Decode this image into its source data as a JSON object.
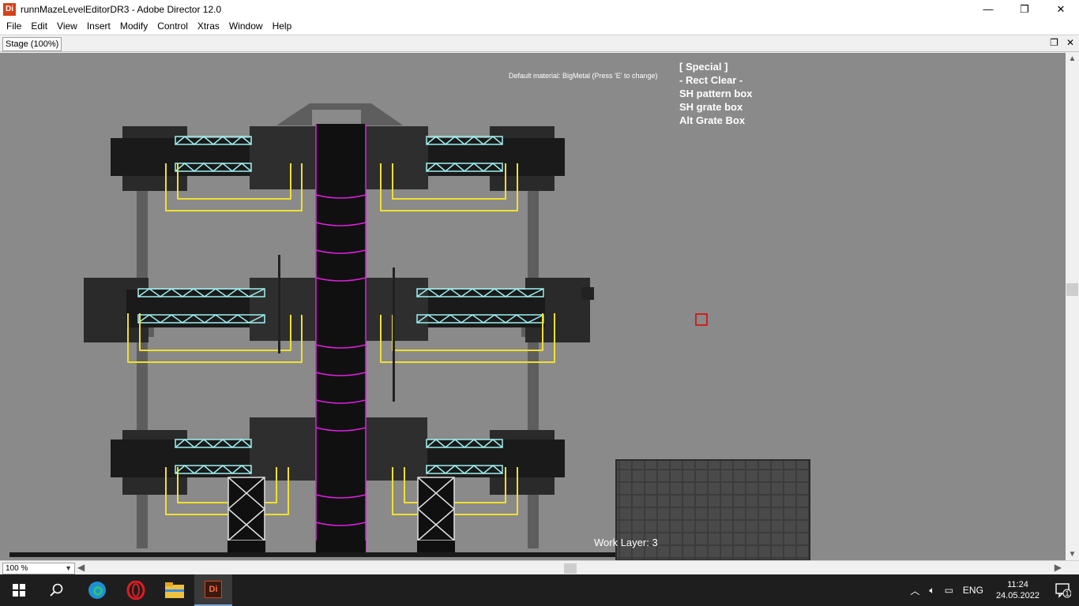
{
  "window": {
    "app_icon_label": "Di",
    "title": "runnMazeLevelEditorDR3 - Adobe Director 12.0",
    "minimize_glyph": "—",
    "restore_glyph": "❐",
    "close_glyph": "✕"
  },
  "menu": {
    "items": [
      "File",
      "Edit",
      "View",
      "Insert",
      "Modify",
      "Control",
      "Xtras",
      "Window",
      "Help"
    ]
  },
  "stage_tab": {
    "label": "Stage (100%)"
  },
  "hud": {
    "material": "Default material: BigMetal (Press 'E' to change)",
    "panel_lines": [
      "[ Special ]",
      "- Rect Clear -",
      "SH pattern box",
      "SH grate box",
      "Alt Grate Box"
    ],
    "work_layer": "Work Layer: 3"
  },
  "bottom": {
    "zoom_value": "100 %"
  },
  "taskbar": {
    "language": "ENG",
    "time": "11:24",
    "date": "24.05.2022",
    "notification_count": "1",
    "director_label": "Di"
  },
  "colors": {
    "stage_bg": "#8a8a8a",
    "pipe_yellow": "#f0e030",
    "column_magenta": "#e020e0",
    "girder_cyan": "#a0f0f0",
    "cursor_red": "#e00000"
  },
  "icons": {
    "start": "windows-start-icon",
    "search": "search-icon",
    "edge": "edge-browser-icon",
    "opera": "opera-browser-icon",
    "explorer": "file-explorer-icon",
    "director": "director-app-icon"
  }
}
